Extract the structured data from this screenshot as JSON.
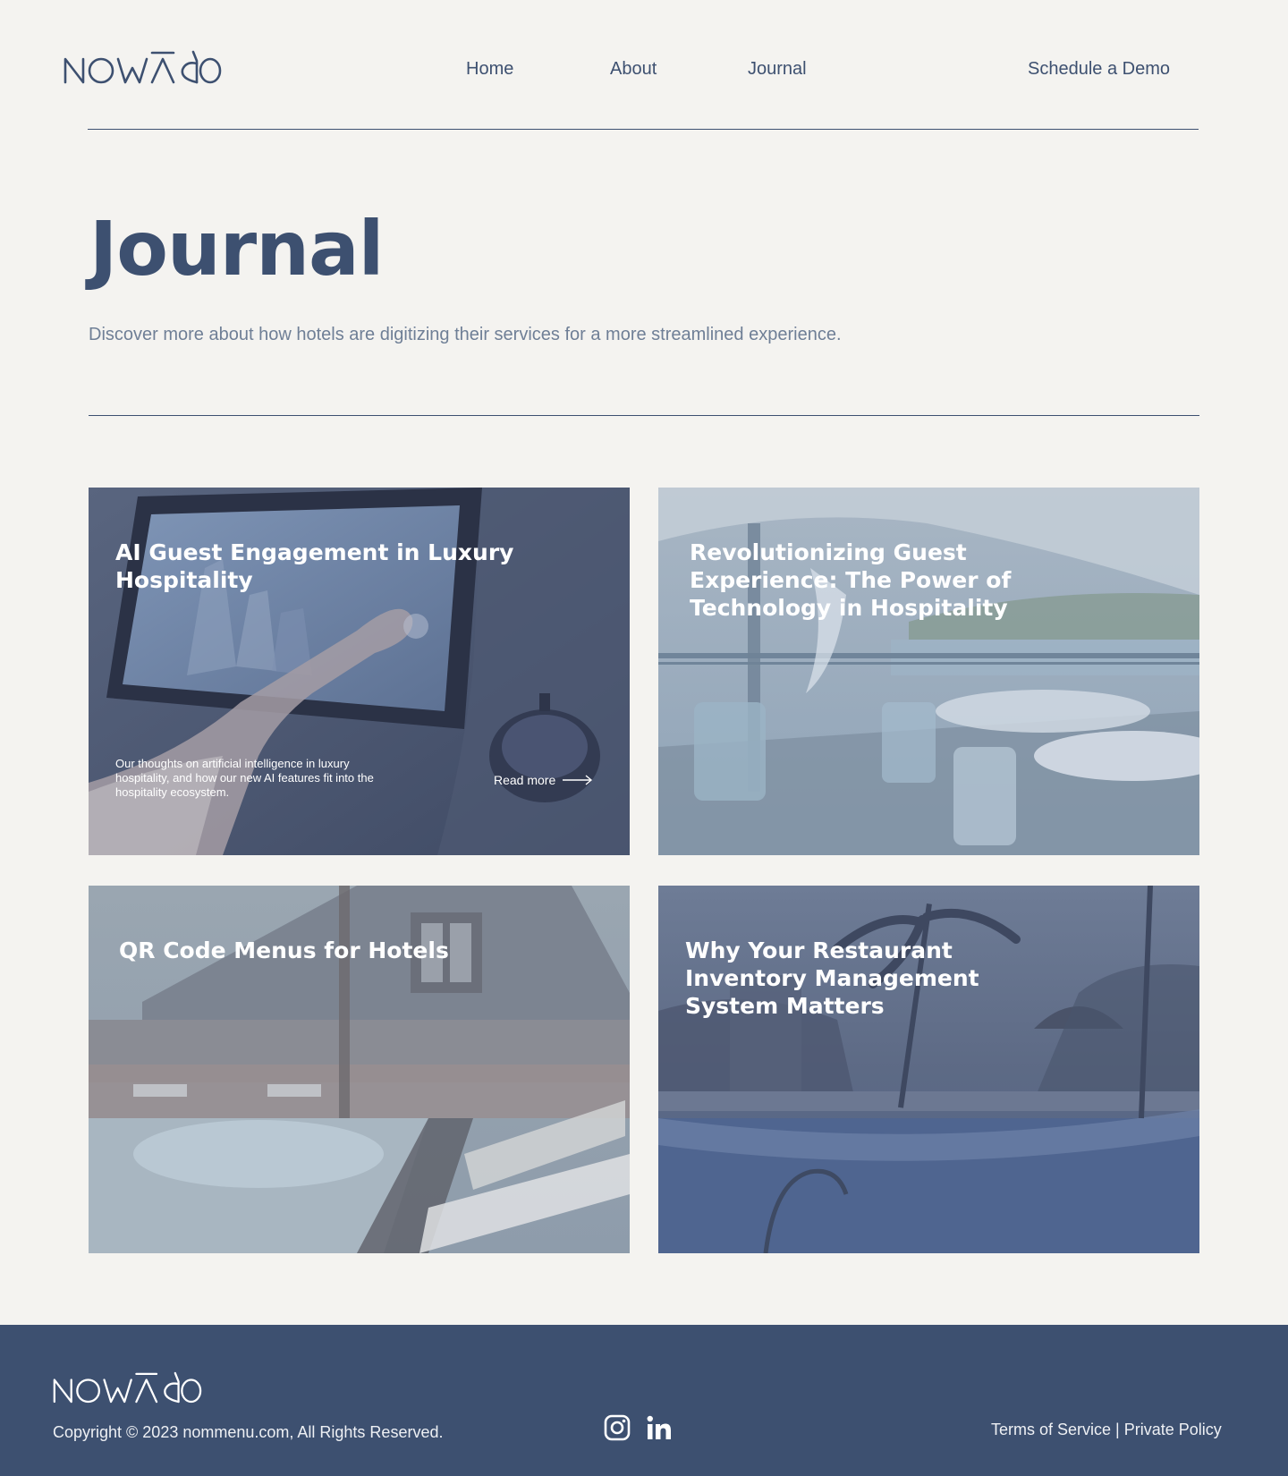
{
  "brand": {
    "logo_text": "NOMĀDO",
    "colors": {
      "primary": "#3d5070",
      "background": "#f4f3f0",
      "muted": "#6f7f96",
      "white": "#ffffff"
    }
  },
  "nav": {
    "items": [
      {
        "label": "Home"
      },
      {
        "label": "About"
      },
      {
        "label": "Journal"
      }
    ],
    "cta_label": "Schedule a Demo"
  },
  "hero": {
    "title": "Journal",
    "subtitle": "Discover more about how hotels are digitizing their services for a more streamlined experience."
  },
  "cards": [
    {
      "title": "AI Guest Engagement in Luxury Hospitality",
      "excerpt": "Our thoughts on artificial intelligence in luxury hospitality, and how our new AI features fit into the hospitality ecosystem.",
      "link_label": "Read more",
      "image": "tablet-kiosk-photo"
    },
    {
      "title": "Revolutionizing Guest Experience: The Power of Technology in Hospitality",
      "image": "terrace-restaurant-photo"
    },
    {
      "title": "QR Code Menus for Hotels",
      "image": "resort-pool-lodge-photo"
    },
    {
      "title": "Why Your Restaurant Inventory Management System Matters",
      "image": "palm-pool-photo"
    }
  ],
  "footer": {
    "logo_text": "NOMĀDO",
    "copyright": "Copyright © 2023 nommenu.com, All Rights Reserved.",
    "social_icons": [
      "instagram-icon",
      "linkedin-icon"
    ],
    "terms_label": "Terms of Service",
    "separator": " | ",
    "privacy_label": "Private Policy"
  }
}
